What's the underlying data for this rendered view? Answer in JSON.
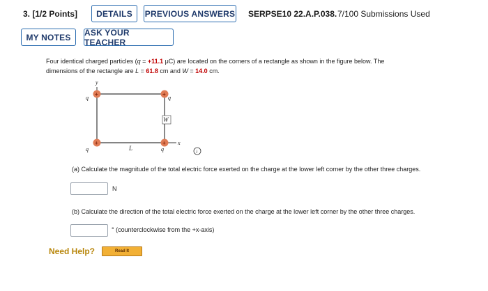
{
  "header": {
    "question_number": "3.",
    "points": "[1/2 Points]",
    "details_label": "DETAILS",
    "previous_answers_label": "PREVIOUS ANSWERS",
    "problem_code": "SERPSE10 22.A.P.038.",
    "submissions": "7/100 Submissions Used"
  },
  "toolbar": {
    "my_notes_label": "MY NOTES",
    "ask_teacher_label": "ASK YOUR TEACHER"
  },
  "question": {
    "text_1": "Four identical charged particles (",
    "q_symbol": "q",
    "eq": " = ",
    "q_value": "+11.1",
    "q_unit": " μC) are located on the corners of a rectangle as shown in the figure below. The",
    "text_2": "dimensions of the rectangle are ",
    "L_symbol": "L",
    "L_value": "61.8",
    "L_unit": " cm and ",
    "W_symbol": "W",
    "W_value": "14.0",
    "W_unit": " cm."
  },
  "figure": {
    "charge_label": "q",
    "x_axis_label": "x",
    "y_axis_label": "y",
    "L_label": "L",
    "W_label": "W",
    "charge_color": "#e07b54",
    "rect_color": "#3a3a3a",
    "info_icon": "info-circle-icon"
  },
  "parts": {
    "a_text": "(a) Calculate the magnitude of the total electric force exerted on the charge at the lower left corner by the other three charges.",
    "a_value": "",
    "a_unit": "N",
    "b_text": "(b) Calculate the direction of the total electric force exerted on the charge at the lower left corner by the other three charges.",
    "b_value": "",
    "b_unit": "° (counterclockwise from the +x-axis)"
  },
  "help": {
    "need_help_label": "Need Help?",
    "read_it_label": "Read It"
  }
}
